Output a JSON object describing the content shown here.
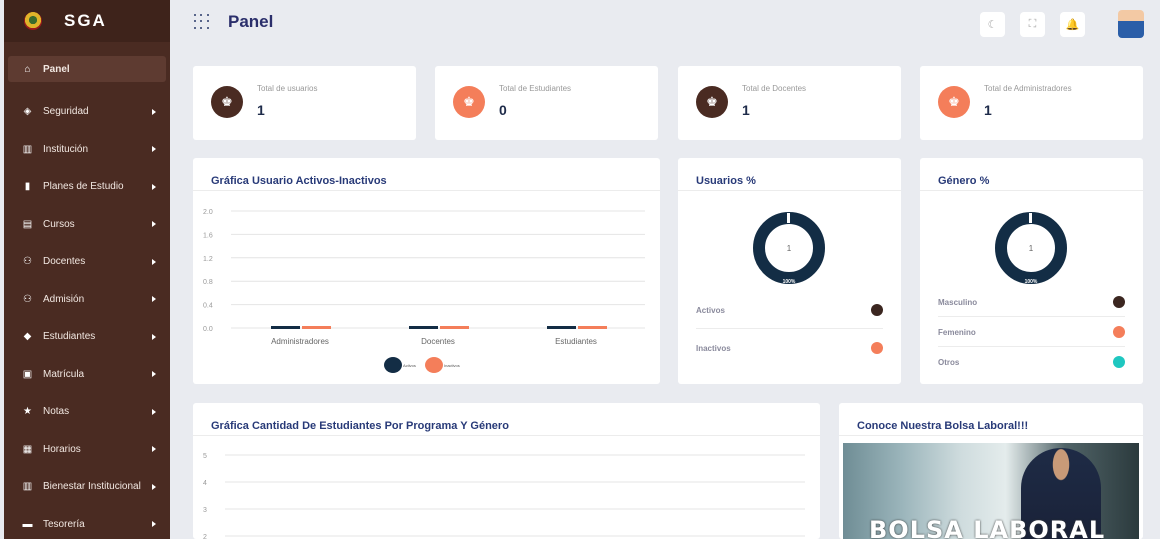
{
  "brand": {
    "name": "SGA"
  },
  "sidebar": {
    "items": [
      {
        "label": "Panel",
        "icon": "home-icon",
        "active": true
      },
      {
        "label": "Seguridad",
        "icon": "shield-icon"
      },
      {
        "label": "Institución",
        "icon": "building-icon"
      },
      {
        "label": "Planes de Estudio",
        "icon": "book-icon"
      },
      {
        "label": "Cursos",
        "icon": "list-icon"
      },
      {
        "label": "Docentes",
        "icon": "users-icon"
      },
      {
        "label": "Admisión",
        "icon": "user-plus-icon"
      },
      {
        "label": "Estudiantes",
        "icon": "graduation-cap-icon"
      },
      {
        "label": "Matrícula",
        "icon": "card-icon"
      },
      {
        "label": "Notas",
        "icon": "star-icon"
      },
      {
        "label": "Horarios",
        "icon": "calendar-icon"
      },
      {
        "label": "Bienestar Institucional",
        "icon": "building-icon"
      },
      {
        "label": "Tesorería",
        "icon": "wallet-icon"
      }
    ]
  },
  "header": {
    "title": "Panel"
  },
  "stats": [
    {
      "label": "Total de usuarios",
      "value": "1",
      "color": "#4a2b22"
    },
    {
      "label": "Total de Estudiantes",
      "value": "0",
      "color": "#f47e5a"
    },
    {
      "label": "Total de Docentes",
      "value": "1",
      "color": "#4a2b22"
    },
    {
      "label": "Total de Administradores",
      "value": "1",
      "color": "#f47e5a"
    }
  ],
  "charts": {
    "activos_title": "Gráfica Usuario Activos-Inactivos",
    "usuarios_title": "Usuarios %",
    "genero_title": "Género %",
    "programa_title": "Gráfica Cantidad De Estudiantes Por Programa Y Género",
    "bolsa_title": "Conoce Nuestra Bolsa Laboral!!!",
    "bolsa_image_text": "BOLSA LABORAL"
  },
  "usuarios_legend": [
    {
      "label": "Activos",
      "color": "#3b2620"
    },
    {
      "label": "Inactivos",
      "color": "#f47e5a"
    }
  ],
  "genero_legend": [
    {
      "label": "Masculino",
      "color": "#3b2620"
    },
    {
      "label": "Femenino",
      "color": "#f47e5a"
    },
    {
      "label": "Otros",
      "color": "#1fc7c0"
    }
  ],
  "chart_data": [
    {
      "type": "bar",
      "title": "Gráfica Usuario Activos-Inactivos",
      "categories": [
        "Administradores",
        "Docentes",
        "Estudiantes"
      ],
      "series": [
        {
          "name": "Activos",
          "values": [
            0,
            0,
            0
          ],
          "color": "#132d45"
        },
        {
          "name": "Inactivos",
          "values": [
            0,
            0,
            0
          ],
          "color": "#f47e5a"
        }
      ],
      "yticks": [
        "2.0",
        "1.6",
        "1.2",
        "0.8",
        "0.4",
        "0.0"
      ],
      "ylim": [
        0,
        2
      ],
      "legend": "bottom"
    },
    {
      "type": "pie",
      "title": "Usuarios %",
      "center_label": "1",
      "slice_label": "100%",
      "values": [
        100
      ],
      "color": "#132d45"
    },
    {
      "type": "pie",
      "title": "Género %",
      "center_label": "1",
      "slice_label": "100%",
      "values": [
        100
      ],
      "color": "#132d45"
    },
    {
      "type": "bar",
      "title": "Gráfica Cantidad De Estudiantes Por Programa Y Género",
      "yticks": [
        "5",
        "4",
        "3",
        "2"
      ]
    }
  ]
}
